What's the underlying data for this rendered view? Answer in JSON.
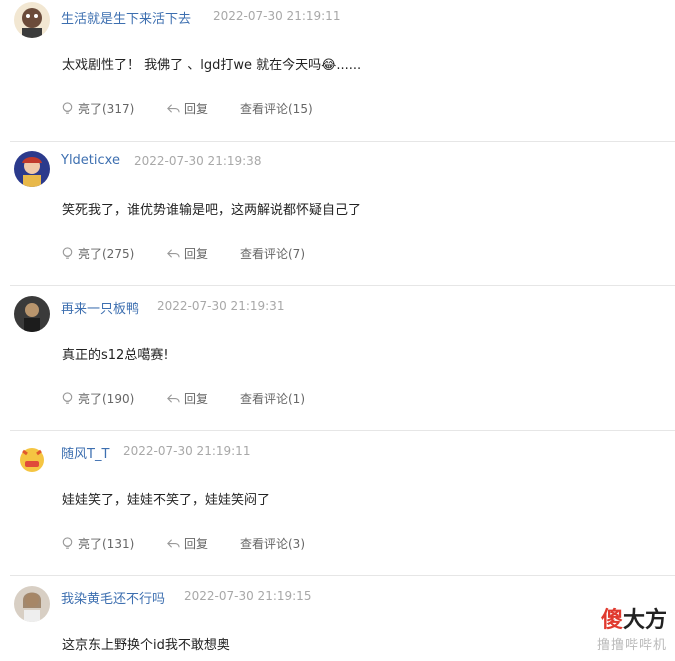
{
  "comments": [
    {
      "username": "生活就是生下来活下去",
      "time": "2022-07-30 21:19:11",
      "text": "太戏剧性了！ 我佛了 、lgd打we 就在今天吗😂......",
      "like_label": "亮了(317)",
      "reply_label": "回复",
      "view_label": "查看评论(15)",
      "avatar_icon": "avatar-cartoon-icon"
    },
    {
      "username": "Yldeticxe",
      "time": "2022-07-30 21:19:38",
      "text": "笑死我了，谁优势谁输是吧，这两解说都怀疑自己了",
      "like_label": "亮了(275)",
      "reply_label": "回复",
      "view_label": "查看评论(7)",
      "avatar_icon": "avatar-character-icon"
    },
    {
      "username": "再来一只板鸭",
      "time": "2022-07-30 21:19:31",
      "text": "真正的s12总噶赛!",
      "like_label": "亮了(190)",
      "reply_label": "回复",
      "view_label": "查看评论(1)",
      "avatar_icon": "avatar-dark-icon"
    },
    {
      "username": "随风T_T",
      "time": "2022-07-30 21:19:11",
      "text": "娃娃笑了，娃娃不笑了，娃娃笑闷了",
      "like_label": "亮了(131)",
      "reply_label": "回复",
      "view_label": "查看评论(3)",
      "avatar_icon": "avatar-emoji-icon"
    },
    {
      "username": "我染黄毛还不行吗",
      "time": "2022-07-30 21:19:15",
      "text": "这京东上野换个id我不敢想奥",
      "avatar_icon": "avatar-photo-icon"
    }
  ],
  "watermark": {
    "brand_red": "傻",
    "brand_rest": "大方",
    "sub": "撸撸哔哔机"
  },
  "colors": {
    "username": "#3d6fb0",
    "timestamp": "#a8a8a8",
    "action": "#666666",
    "divider": "#e6e6e6",
    "brand_red": "#e03a2f"
  }
}
